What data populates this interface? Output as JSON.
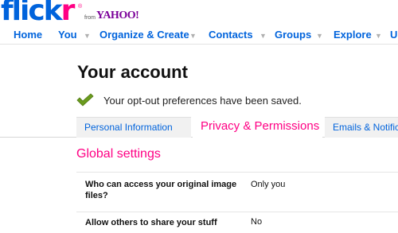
{
  "logo": {
    "flick": "flick",
    "r": "r",
    "reg": "®",
    "from": "from",
    "yahoo": "YAHOO!"
  },
  "nav": {
    "home": "Home",
    "you": "You",
    "organize": "Organize & Create",
    "contacts": "Contacts",
    "groups": "Groups",
    "explore": "Explore",
    "upload_partial": "U",
    "arrow": "▼"
  },
  "page": {
    "title": "Your account",
    "saved_message": "Your opt-out preferences have been saved."
  },
  "tabs": {
    "personal": "Personal Information",
    "privacy": "Privacy & Permissions",
    "emails": "Emails & Notifications"
  },
  "settings": {
    "section_title": "Global settings",
    "rows": [
      {
        "label": "Who can access your original image files?",
        "value": "Only you"
      },
      {
        "label": "Allow others to share your stuff",
        "value": "No"
      }
    ]
  },
  "colors": {
    "blue": "#0063dc",
    "pink": "#ff0084",
    "check_green": "#6a9b1d"
  }
}
